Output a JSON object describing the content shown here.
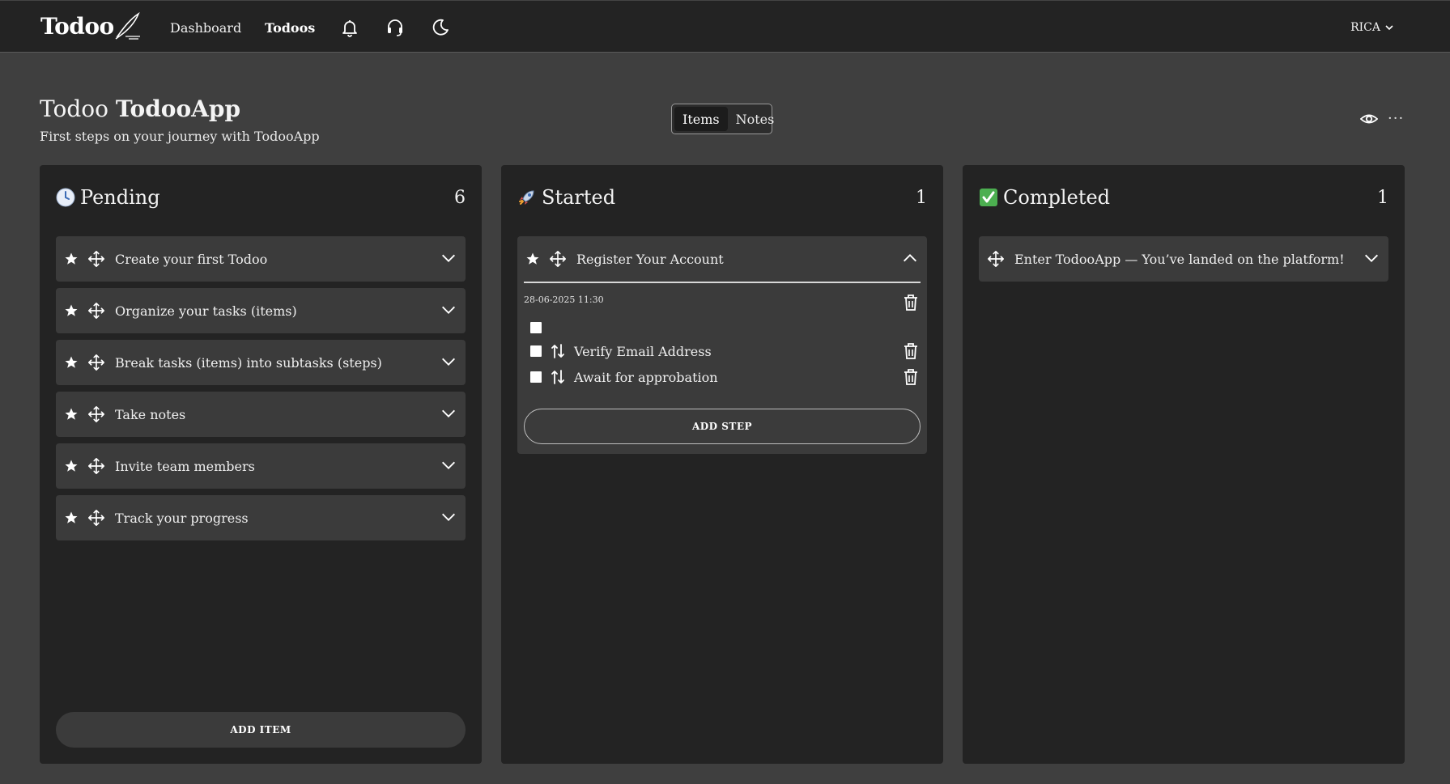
{
  "navbar": {
    "logo_text": "Todoo",
    "links": {
      "dashboard": "Dashboard",
      "todoos": "Todoos"
    },
    "icons": {
      "notifications": "bell-icon",
      "support": "headset-icon",
      "theme": "moon-icon"
    },
    "user": "RICA"
  },
  "header": {
    "title_prefix": "Todoo",
    "title_name": "TodooApp",
    "subtitle": "First steps on your journey with TodooApp",
    "view_toggle": {
      "items": "Items",
      "notes": "Notes",
      "selected": "Items"
    },
    "more": "···"
  },
  "columns": {
    "pending": {
      "emoji": "clock-icon",
      "title": "Pending",
      "count": "6",
      "items": [
        {
          "label": "Create your first Todoo"
        },
        {
          "label": "Organize your tasks (items)"
        },
        {
          "label": "Break tasks (items) into subtasks (steps)"
        },
        {
          "label": "Take notes"
        },
        {
          "label": "Invite team members"
        },
        {
          "label": "Track your progress"
        }
      ],
      "add_button": "ADD ITEM"
    },
    "started": {
      "emoji": "rocket-icon",
      "title": "Started",
      "count": "1",
      "card": {
        "label": "Register Your Account",
        "date": "28-06-2025 11:30",
        "steps": [
          {
            "label": "Verify Email Address",
            "checked": false
          },
          {
            "label": "Await for approbation",
            "checked": false
          }
        ],
        "add_step": "ADD STEP"
      }
    },
    "completed": {
      "emoji": "check-mark-icon",
      "title": "Completed",
      "count": "1",
      "items": [
        {
          "label": "Enter TodooApp — You’ve landed on the platform!"
        }
      ]
    }
  },
  "colors": {
    "background": "#3f3f3f",
    "navbar": "#232323",
    "column": "#232323",
    "card": "#3b3b3b",
    "text": "#f2f2f2",
    "check_green": "#4caf50"
  }
}
